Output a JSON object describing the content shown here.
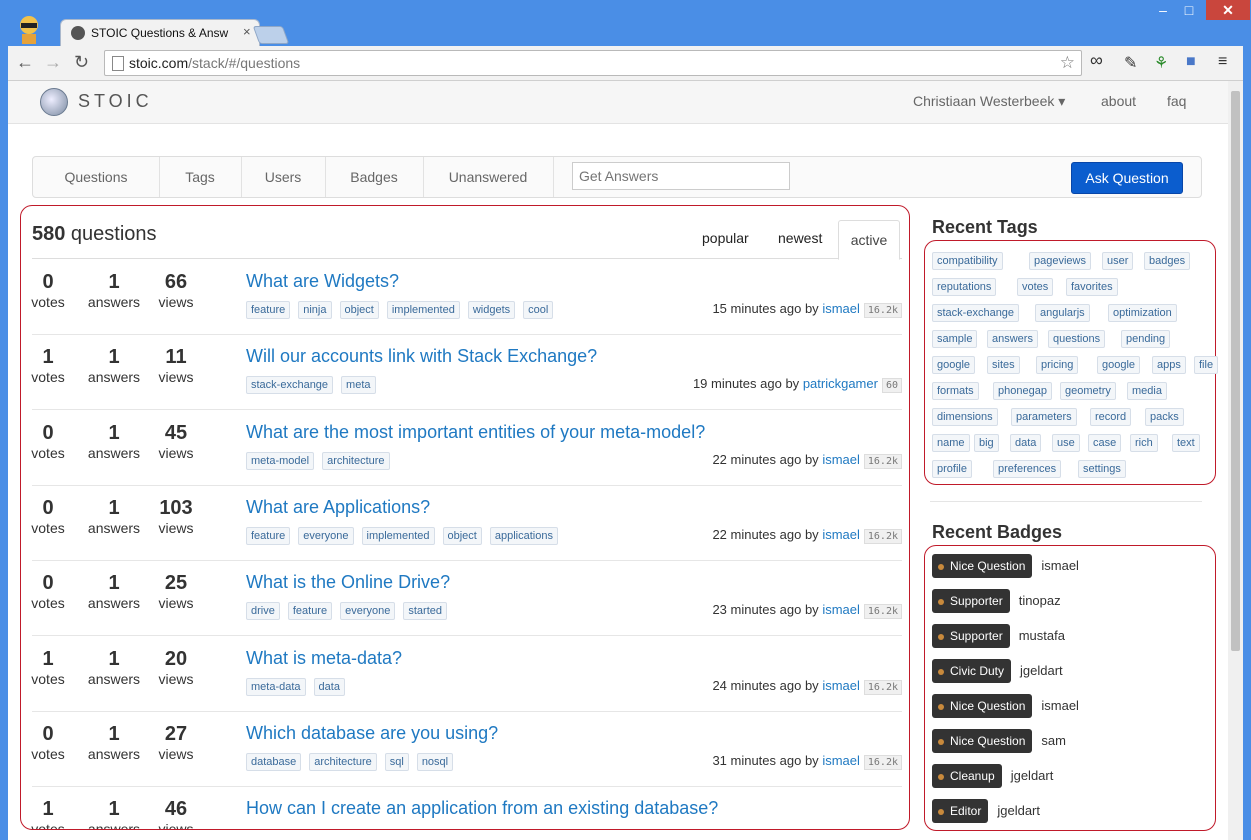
{
  "browser": {
    "tab_title": "STOIC Questions & Answ",
    "tab_close": "×",
    "url_host": "stoic.com",
    "url_path": "/stack/#/questions",
    "win_min": "–",
    "win_max": "□",
    "win_close": "✕"
  },
  "site": {
    "logo": "STOIC",
    "user_name": "Christiaan Westerbeek ▾",
    "about": "about",
    "faq": "faq"
  },
  "subnav": {
    "items": [
      "Questions",
      "Tags",
      "Users",
      "Badges",
      "Unanswered"
    ],
    "search_placeholder": "Get Answers",
    "ask": "Ask Question"
  },
  "list": {
    "count": "580",
    "count_label": " questions",
    "sort": [
      "popular",
      "newest",
      "active"
    ],
    "votes_label": "votes",
    "answers_label": "answers",
    "views_label": "views",
    "by": " by ",
    "questions": [
      {
        "votes": "0",
        "answers": "1",
        "views": "66",
        "title": "What are Widgets?",
        "tags": [
          "feature",
          "ninja",
          "object",
          "implemented",
          "widgets",
          "cool"
        ],
        "time": "15 minutes ago",
        "user": "ismael",
        "rep": "16.2k"
      },
      {
        "votes": "1",
        "answers": "1",
        "views": "11",
        "title": "Will our accounts link with Stack Exchange?",
        "tags": [
          "stack-exchange",
          "meta"
        ],
        "time": "19 minutes ago",
        "user": "patrickgamer",
        "rep": "60"
      },
      {
        "votes": "0",
        "answers": "1",
        "views": "45",
        "title": "What are the most important entities of your meta-model?",
        "tags": [
          "meta-model",
          "architecture"
        ],
        "time": "22 minutes ago",
        "user": "ismael",
        "rep": "16.2k"
      },
      {
        "votes": "0",
        "answers": "1",
        "views": "103",
        "title": "What are Applications?",
        "tags": [
          "feature",
          "everyone",
          "implemented",
          "object",
          "applications"
        ],
        "time": "22 minutes ago",
        "user": "ismael",
        "rep": "16.2k"
      },
      {
        "votes": "0",
        "answers": "1",
        "views": "25",
        "title": "What is the Online Drive?",
        "tags": [
          "drive",
          "feature",
          "everyone",
          "started"
        ],
        "time": "23 minutes ago",
        "user": "ismael",
        "rep": "16.2k"
      },
      {
        "votes": "1",
        "answers": "1",
        "views": "20",
        "title": "What is meta-data?",
        "tags": [
          "meta-data",
          "data"
        ],
        "time": "24 minutes ago",
        "user": "ismael",
        "rep": "16.2k"
      },
      {
        "votes": "0",
        "answers": "1",
        "views": "27",
        "title": "Which database are you using?",
        "tags": [
          "database",
          "architecture",
          "sql",
          "nosql"
        ],
        "time": "31 minutes ago",
        "user": "ismael",
        "rep": "16.2k"
      },
      {
        "votes": "1",
        "answers": "1",
        "views": "46",
        "title": "How can I create an application from an existing database?",
        "tags": [],
        "time": "",
        "user": "",
        "rep": ""
      }
    ]
  },
  "sidebar": {
    "recent_tags_title": "Recent Tags",
    "recent_tags": [
      "compatibility",
      "pageviews",
      "user",
      "badges",
      "reputations",
      "votes",
      "favorites",
      "stack-exchange",
      "angularjs",
      "optimization",
      "sample",
      "answers",
      "questions",
      "pending",
      "google",
      "sites",
      "pricing",
      "google",
      "apps",
      "file",
      "formats",
      "phonegap",
      "geometry",
      "media",
      "dimensions",
      "parameters",
      "record",
      "packs",
      "name",
      "big",
      "data",
      "use",
      "case",
      "rich",
      "text",
      "profile",
      "preferences",
      "settings"
    ],
    "recent_badges_title": "Recent Badges",
    "recent_badges": [
      {
        "badge": "Nice Question",
        "user": "ismael"
      },
      {
        "badge": "Supporter",
        "user": "tinopaz"
      },
      {
        "badge": "Supporter",
        "user": "mustafa"
      },
      {
        "badge": "Civic Duty",
        "user": "jgeldart"
      },
      {
        "badge": "Nice Question",
        "user": "ismael"
      },
      {
        "badge": "Nice Question",
        "user": "sam"
      },
      {
        "badge": "Cleanup",
        "user": "jgeldart"
      },
      {
        "badge": "Editor",
        "user": "jgeldart"
      }
    ]
  }
}
